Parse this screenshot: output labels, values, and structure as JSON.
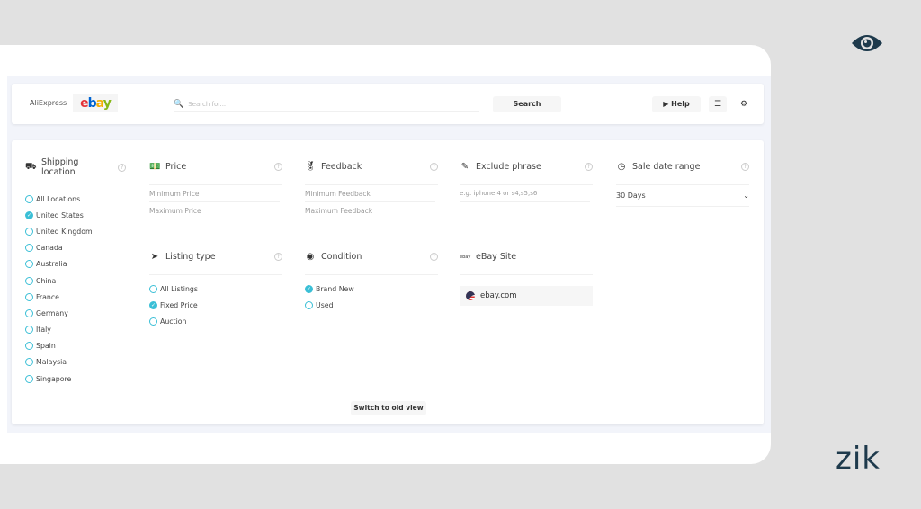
{
  "brand": {
    "logo_text": "zik",
    "eye_icon": "eye-icon",
    "color": "#1e3a4c"
  },
  "topbar": {
    "tab_aliexpress": "AliExpress",
    "tab_ebay": "ebay",
    "search_placeholder": "Search for...",
    "search_button": "Search",
    "help_button": "Help"
  },
  "filters": {
    "shipping": {
      "title": "Shipping location",
      "options": [
        {
          "label": "All Locations",
          "checked": false
        },
        {
          "label": "United States",
          "checked": true
        },
        {
          "label": "United Kingdom",
          "checked": false
        },
        {
          "label": "Canada",
          "checked": false
        },
        {
          "label": "Australia",
          "checked": false
        },
        {
          "label": "China",
          "checked": false
        },
        {
          "label": "France",
          "checked": false
        },
        {
          "label": "Germany",
          "checked": false
        },
        {
          "label": "Italy",
          "checked": false
        },
        {
          "label": "Spain",
          "checked": false
        },
        {
          "label": "Malaysia",
          "checked": false
        },
        {
          "label": "Singapore",
          "checked": false
        }
      ]
    },
    "price": {
      "title": "Price",
      "min_placeholder": "Minimum Price",
      "max_placeholder": "Maximum Price"
    },
    "feedback": {
      "title": "Feedback",
      "min_placeholder": "Minimum Feedback",
      "max_placeholder": "Maximum Feedback"
    },
    "exclude": {
      "title": "Exclude phrase",
      "placeholder": "e.g. iphone 4 or s4,s5,s6"
    },
    "sale_date": {
      "title": "Sale date range",
      "value": "30 Days"
    },
    "listing_type": {
      "title": "Listing type",
      "options": [
        {
          "label": "All Listings",
          "checked": false
        },
        {
          "label": "Fixed Price",
          "checked": true
        },
        {
          "label": "Auction",
          "checked": false
        }
      ]
    },
    "condition": {
      "title": "Condition",
      "options": [
        {
          "label": "Brand New",
          "checked": true
        },
        {
          "label": "Used",
          "checked": false
        }
      ]
    },
    "ebay_site": {
      "title": "eBay Site",
      "value": "ebay.com"
    }
  },
  "switch_button": "Switch to old view",
  "accent": "#3bbfd6"
}
